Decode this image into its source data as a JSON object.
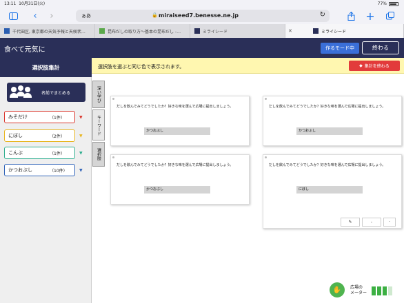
{
  "status": {
    "time": "13:11",
    "date": "10月31日(火)",
    "battery": "77%"
  },
  "browser": {
    "aa": "ぁあ",
    "url": "miraiseed7.benesse.ne.jp",
    "tabs": [
      {
        "label": "千代田区, 東京都の天気予報と天候状…"
      },
      {
        "label": "昆布だしの取り方〜基本の昆布だし -…"
      },
      {
        "label": "ミライシード"
      },
      {
        "label": "ミライシード"
      }
    ]
  },
  "header": {
    "title": "食べて元気に",
    "mode_button": "作るモード中",
    "end_button": "終わる"
  },
  "sidebar": {
    "title": "選択肢集計",
    "group_button": "名前でまとめる",
    "choices": [
      {
        "name": "みそだけ",
        "count": "（1件）",
        "color": "#d9352c"
      },
      {
        "name": "にぼし",
        "count": "（2件）",
        "color": "#e8b520"
      },
      {
        "name": "こんぶ",
        "count": "（1件）",
        "color": "#2fae8f"
      },
      {
        "name": "かつおぶし",
        "count": "（10件）",
        "color": "#2f63b8"
      }
    ]
  },
  "side_tabs": [
    "深い学び",
    "キーワード",
    "選択肢"
  ],
  "notice": {
    "text": "選択肢を選ぶと同じ色で表示されます。",
    "finish_button": "集計を終わる"
  },
  "cards": [
    {
      "question": "だしを飲んでみてどうでしたか？好きな味を選んで広場に提出しましょう。",
      "answer": "かつおぶし"
    },
    {
      "question": "だしを飲んでみてどうでしたか？好きな味を選んで広場に提出しましょう。",
      "answer": "かつおぶし"
    },
    {
      "question": "だしを飲んでみてどうでしたか？好きな味を選んで広場に提出しましょう。",
      "answer": "かつおぶし"
    },
    {
      "question": "だしを飲んでみてどうでしたか？好きな味を選んで広場に提出しましょう。",
      "answer": "にぼし"
    }
  ],
  "meter": {
    "label_line1": "広場の",
    "label_line2": "メーター",
    "level_fraction": 0.75
  }
}
